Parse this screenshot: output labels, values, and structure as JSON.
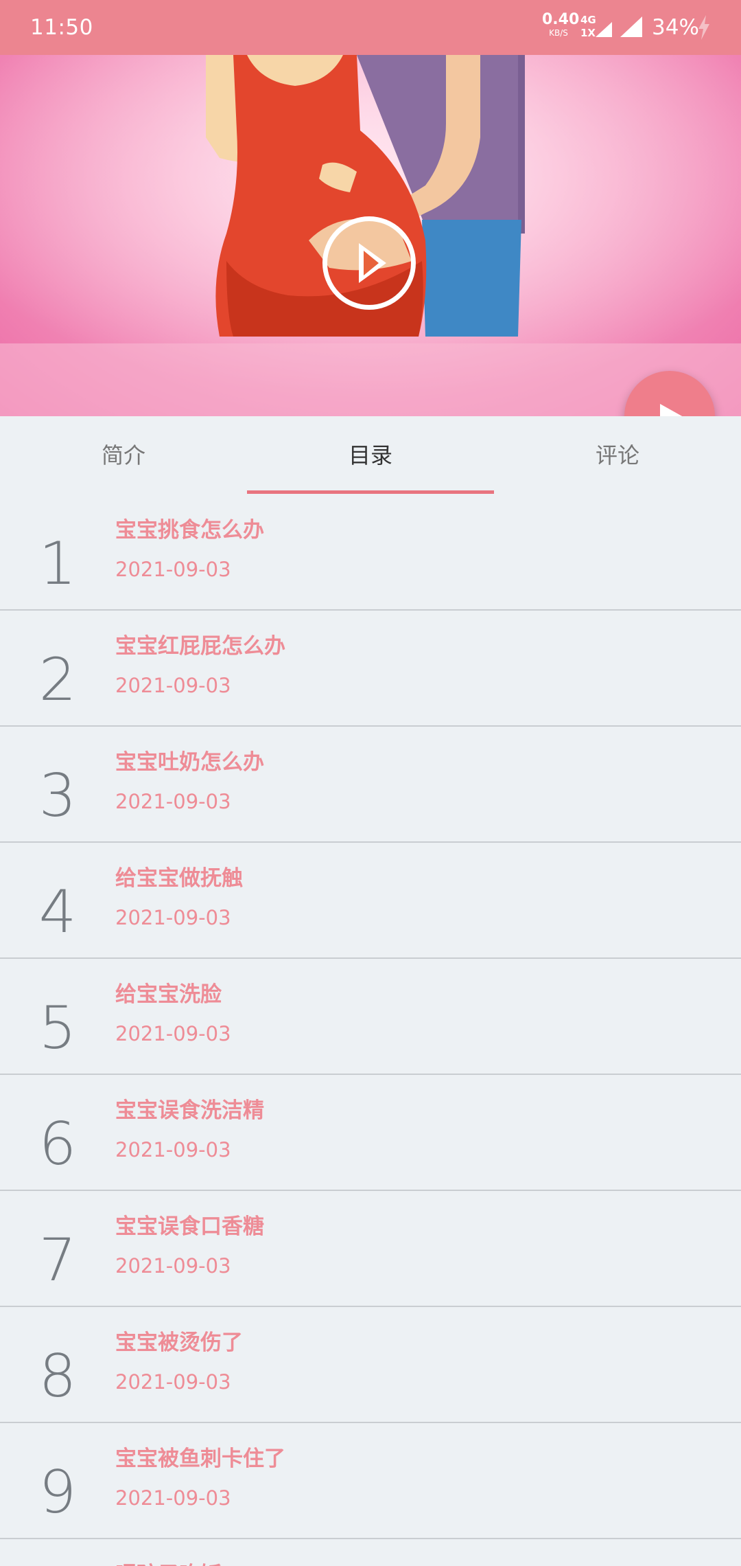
{
  "status_bar": {
    "time": "11:50",
    "net_speed_value": "0.40",
    "net_speed_unit": "KB/S",
    "network_label": "4G",
    "network_sub": "1X",
    "battery": "34%"
  },
  "tabs": [
    {
      "label": "简介"
    },
    {
      "label": "目录"
    },
    {
      "label": "评论"
    }
  ],
  "active_tab": "目录",
  "items": [
    {
      "num": "1",
      "title": "宝宝挑食怎么办",
      "date": "2021-09-03"
    },
    {
      "num": "2",
      "title": "宝宝红屁屁怎么办",
      "date": "2021-09-03"
    },
    {
      "num": "3",
      "title": "宝宝吐奶怎么办",
      "date": "2021-09-03"
    },
    {
      "num": "4",
      "title": "给宝宝做抚触",
      "date": "2021-09-03"
    },
    {
      "num": "5",
      "title": "给宝宝洗脸",
      "date": "2021-09-03"
    },
    {
      "num": "6",
      "title": "宝宝误食洗洁精",
      "date": "2021-09-03"
    },
    {
      "num": "7",
      "title": "宝宝误食口香糖",
      "date": "2021-09-03"
    },
    {
      "num": "8",
      "title": "宝宝被烫伤了",
      "date": "2021-09-03"
    },
    {
      "num": "9",
      "title": "宝宝被鱼刺卡住了",
      "date": "2021-09-03"
    },
    {
      "num": "",
      "title": "喂孩子吃饭",
      "date": ""
    }
  ],
  "colors": {
    "accent": "#ec8590",
    "item_text": "#ee8c96",
    "background": "#edf1f4"
  }
}
